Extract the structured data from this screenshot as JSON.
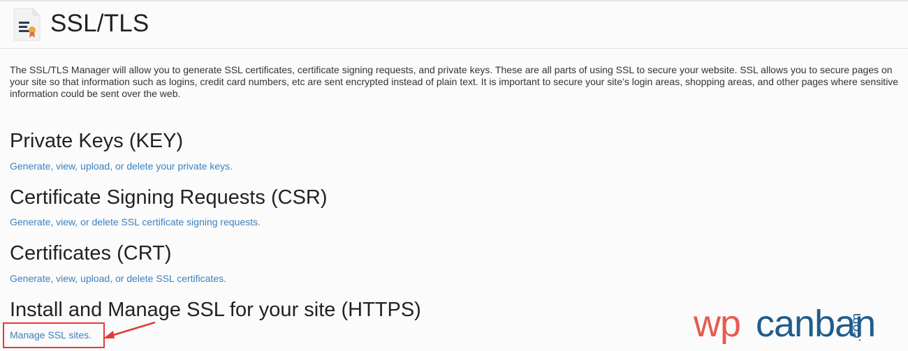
{
  "header": {
    "title": "SSL/TLS",
    "icon": "certificate-document-icon"
  },
  "intro": {
    "text": "The SSL/TLS Manager will allow you to generate SSL certificates, certificate signing requests, and private keys. These are all parts of using SSL to secure your website. SSL allows you to secure pages on your site so that information such as logins, credit card numbers, etc are sent encrypted instead of plain text. It is important to secure your site’s login areas, shopping areas, and other pages where sensitive information could be sent over the web."
  },
  "sections": [
    {
      "heading": "Private Keys (KEY)",
      "link": "Generate, view, upload, or delete your private keys."
    },
    {
      "heading": "Certificate Signing Requests (CSR)",
      "link": "Generate, view, or delete SSL certificate signing requests."
    },
    {
      "heading": "Certificates (CRT)",
      "link": "Generate, view, upload, or delete SSL certificates."
    },
    {
      "heading": "Install and Manage SSL for your site (HTTPS)",
      "link": "Manage SSL sites."
    }
  ],
  "watermark": {
    "part1": "wp",
    "part2": "canban",
    "part3": ".com"
  },
  "colors": {
    "link": "#3a81c2",
    "highlight": "#e53935",
    "brand_red": "#e85a4f",
    "brand_blue": "#1f5d8c"
  }
}
